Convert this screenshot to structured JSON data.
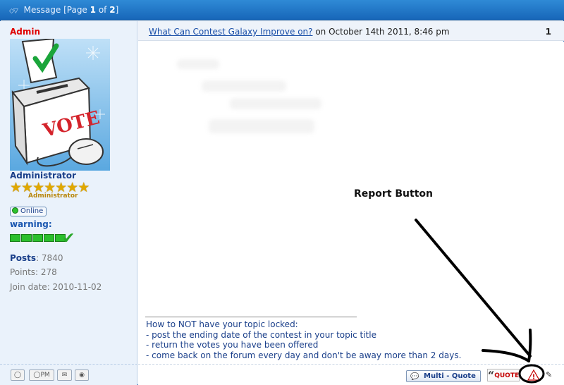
{
  "header": {
    "arrows": "◇▽",
    "prefix": "Message [Page ",
    "current_page": "1",
    "of": " of ",
    "total_pages": "2",
    "suffix": "]"
  },
  "author": {
    "name": "Admin",
    "role": "Administrator",
    "role_small": "Administrator",
    "stars": "★★★★★★★",
    "status": "Online",
    "warning_label": "warning:",
    "avatar_text": "VOTE",
    "stats": [
      {
        "label": "Posts",
        "value": ": 7840"
      },
      {
        "label": "Points",
        "value": ": 278"
      },
      {
        "label": "Join date",
        "value": ": 2010-11-02"
      }
    ]
  },
  "post": {
    "title_link": "What Can Contest Galaxy Improve on?",
    "date": " on October 14th 2011, 8:46 pm",
    "number": "1",
    "signature": [
      "How to NOT have your topic locked:",
      "- post the ending date of the contest in your topic title",
      "- return the votes you have been offered",
      "- come back on the forum every day and don't be away more than 2 days."
    ]
  },
  "annotation": {
    "label": "Report Button"
  },
  "footer": {
    "sidebar_buttons": [
      "profile",
      "pm",
      "email",
      "website"
    ],
    "pm_label": "PM",
    "multi_quote": "Multi - Quote",
    "quote": "QUOTE",
    "quote_mark": "“",
    "report": "!",
    "edit": "✎"
  },
  "colors": {
    "header_bg": "#1f77c8",
    "sidebar_bg": "#eaf2fb",
    "username": "#e00000",
    "link": "#1a4fa8"
  }
}
